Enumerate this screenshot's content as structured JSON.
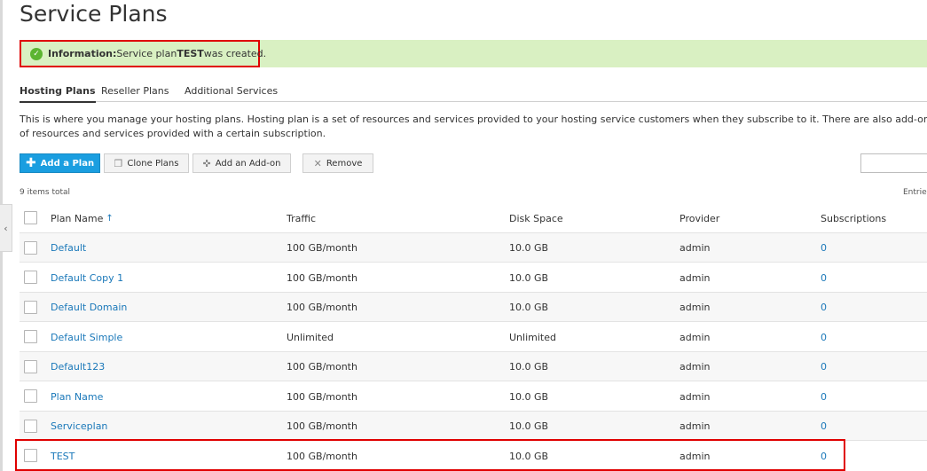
{
  "title": "Service Plans",
  "info": {
    "prefix": "Information:",
    "text_before": " Service plan ",
    "plan_name": "TEST",
    "text_after": " was created."
  },
  "tabs": [
    {
      "label": "Hosting Plans",
      "active": true
    },
    {
      "label": "Reseller Plans",
      "active": false
    },
    {
      "label": "Additional Services",
      "active": false
    }
  ],
  "description": {
    "line1": "This is where you manage your hosting plans. Hosting plan is a set of resources and services provided to your hosting service customers when they subscribe to it. There are also add-on plans that e",
    "line2": "of resources and services provided with a certain subscription."
  },
  "toolbar": {
    "add_plan": "Add a Plan",
    "clone_plans": "Clone Plans",
    "add_addon": "Add an Add-on",
    "remove": "Remove"
  },
  "items_total": "9 items total",
  "entries_label": "Entrie",
  "columns": {
    "plan_name": "Plan Name",
    "sort_indicator": "↑",
    "traffic": "Traffic",
    "disk_space": "Disk Space",
    "provider": "Provider",
    "subscriptions": "Subscriptions"
  },
  "rows": [
    {
      "name": "Default",
      "traffic": "100 GB/month",
      "disk": "10.0 GB",
      "provider": "admin",
      "subscriptions": "0"
    },
    {
      "name": "Default Copy 1",
      "traffic": "100 GB/month",
      "disk": "10.0 GB",
      "provider": "admin",
      "subscriptions": "0"
    },
    {
      "name": "Default Domain",
      "traffic": "100 GB/month",
      "disk": "10.0 GB",
      "provider": "admin",
      "subscriptions": "0"
    },
    {
      "name": "Default Simple",
      "traffic": "Unlimited",
      "disk": "Unlimited",
      "provider": "admin",
      "subscriptions": "0"
    },
    {
      "name": "Default123",
      "traffic": "100 GB/month",
      "disk": "10.0 GB",
      "provider": "admin",
      "subscriptions": "0"
    },
    {
      "name": "Plan Name",
      "traffic": "100 GB/month",
      "disk": "10.0 GB",
      "provider": "admin",
      "subscriptions": "0"
    },
    {
      "name": "Serviceplan",
      "traffic": "100 GB/month",
      "disk": "10.0 GB",
      "provider": "admin",
      "subscriptions": "0"
    },
    {
      "name": "TEST",
      "traffic": "100 GB/month",
      "disk": "10.0 GB",
      "provider": "admin",
      "subscriptions": "0"
    }
  ],
  "colors": {
    "accent": "#1a9ee0",
    "link": "#1a78b9",
    "success_bg": "#d9f0c2",
    "success_icon": "#5cb531",
    "highlight": "#e00000"
  }
}
